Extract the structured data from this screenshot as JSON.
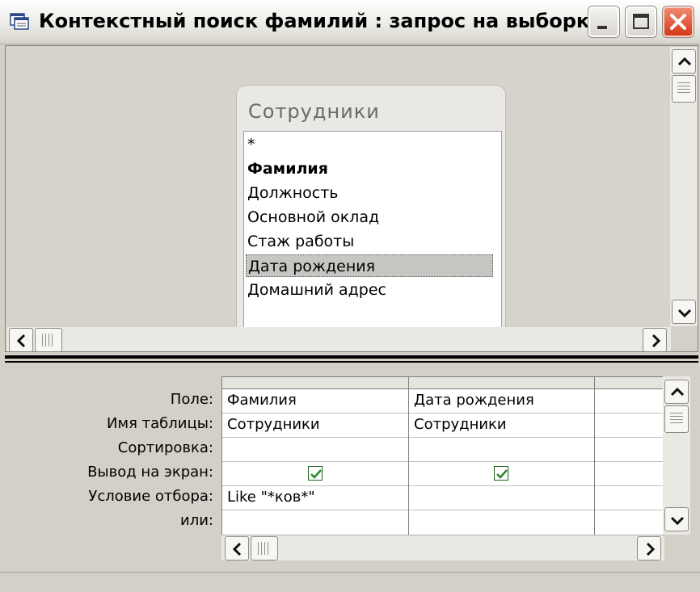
{
  "window": {
    "title": "Контекстный поиск фамилий : запрос на выборку"
  },
  "table": {
    "title": "Сотрудники",
    "fields": [
      "*",
      "Фамилия",
      "Должность",
      "Основной оклад",
      "Стаж работы",
      "Дата рождения",
      "Домашний адрес"
    ],
    "selected_field": "Дата рождения",
    "bold_field": "Фамилия"
  },
  "grid": {
    "row_labels": {
      "field": "Поле:",
      "table": "Имя таблицы:",
      "sort": "Сортировка:",
      "show": "Вывод на экран:",
      "criteria": "Условие отбора:",
      "or": "или:"
    },
    "columns": [
      {
        "field": "Фамилия",
        "table": "Сотрудники",
        "sort": "",
        "show": true,
        "criteria": "Like \"*ков*\"",
        "or": ""
      },
      {
        "field": "Дата рождения",
        "table": "Сотрудники",
        "sort": "",
        "show": true,
        "criteria": "",
        "or": ""
      },
      {
        "field": "",
        "table": "",
        "sort": "",
        "show": false,
        "criteria": "",
        "or": ""
      }
    ]
  },
  "icons": {
    "app": "query-window-icon",
    "minimize": "minimize-icon",
    "maximize": "maximize-icon",
    "close": "close-icon",
    "up": "scroll-up-arrow-icon",
    "down": "scroll-down-arrow-icon",
    "left": "scroll-left-arrow-icon",
    "right": "scroll-right-arrow-icon",
    "check": "checkmark-icon"
  },
  "colors": {
    "close_button": "#d5391a",
    "checkbox_mark": "#2a8a2a",
    "selected_field_bg": "#c8c6c3"
  }
}
